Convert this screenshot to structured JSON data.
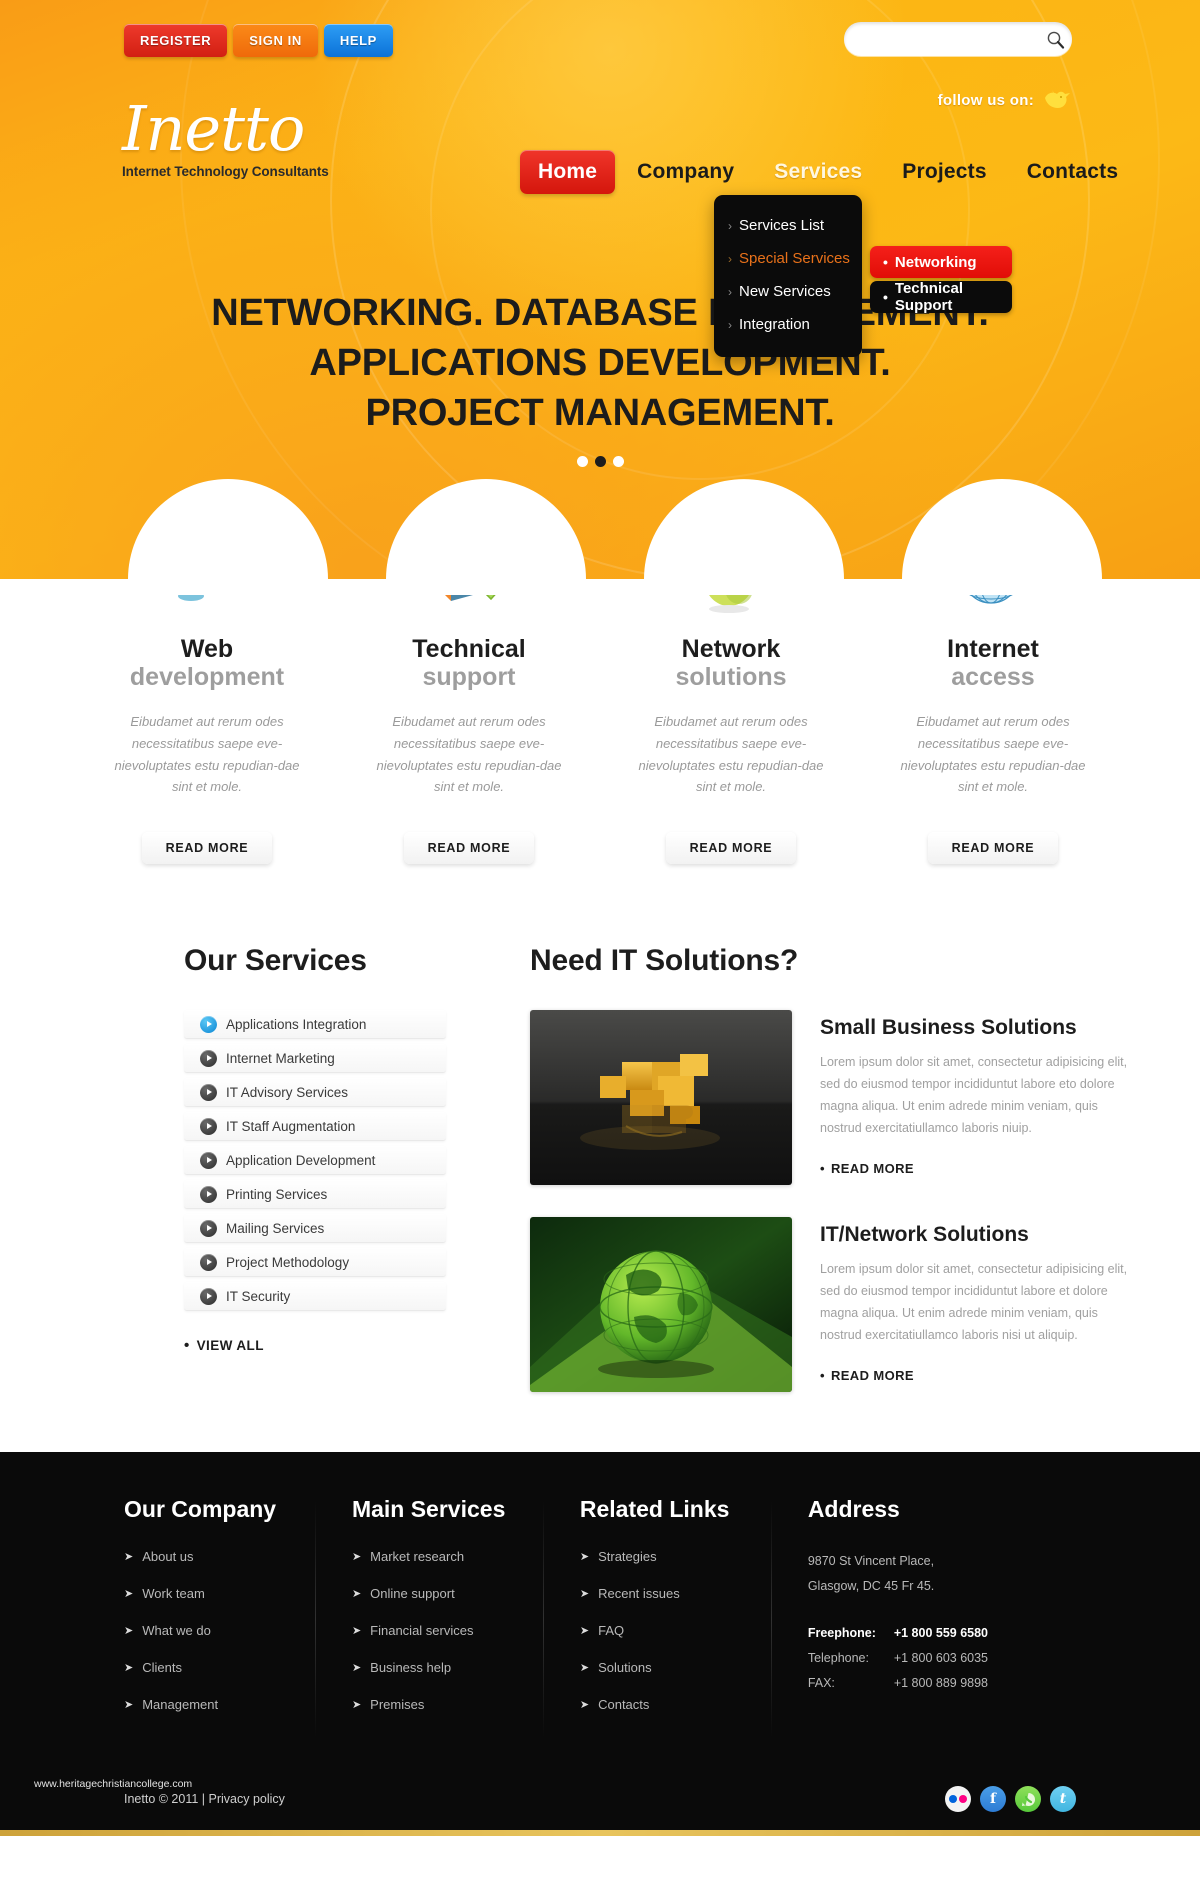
{
  "header": {
    "auth_buttons": [
      {
        "label": "REGISTER",
        "name": "register-button"
      },
      {
        "label": "SIGN IN",
        "name": "signin-button"
      },
      {
        "label": "HELP",
        "name": "help-button"
      }
    ],
    "search": {
      "value": "",
      "placeholder": "",
      "icon": "search-icon"
    },
    "follow_label": "follow us on:",
    "follow_icon": "twitter-bird-icon",
    "logo_name": "Inetto",
    "logo_tagline": "Internet Technology Consultants"
  },
  "nav": {
    "items": [
      {
        "label": "Home",
        "state": "active"
      },
      {
        "label": "Company",
        "state": "normal"
      },
      {
        "label": "Services",
        "state": "hovered"
      },
      {
        "label": "Projects",
        "state": "normal"
      },
      {
        "label": "Contacts",
        "state": "normal"
      }
    ],
    "dropdown": [
      {
        "label": "Services List",
        "state": "normal"
      },
      {
        "label": "Special Services",
        "state": "highlighted"
      },
      {
        "label": "New Services",
        "state": "normal"
      },
      {
        "label": "Integration",
        "state": "normal"
      }
    ],
    "submenu": [
      {
        "label": "Networking",
        "state": "active"
      },
      {
        "label": "Technical Support",
        "state": "normal"
      }
    ]
  },
  "hero": {
    "headline_line1": "NETWORKING. DATABASE MANAGEMENT.",
    "headline_line2": "APPLICATIONS DEVELOPMENT.",
    "headline_line3": "PROJECT MANAGEMENT.",
    "slider_dots": 3,
    "active_dot": 1
  },
  "cards": [
    {
      "title": "Web",
      "subtitle": "development",
      "text": "Eibudamet aut rerum odes necessitatibus saepe eve-nievoluptates estu repudian-dae sint et mole.",
      "more": "READ MORE",
      "icon": "monitor-cubes-icon"
    },
    {
      "title": "Technical",
      "subtitle": "support",
      "text": "Eibudamet aut rerum odes necessitatibus saepe eve-nievoluptates estu repudian-dae sint et mole.",
      "more": "READ MORE",
      "icon": "disk-download-icon"
    },
    {
      "title": "Network",
      "subtitle": "solutions",
      "text": "Eibudamet aut rerum odes necessitatibus saepe eve-nievoluptates estu repudian-dae sint et mole.",
      "more": "READ MORE",
      "icon": "green-apple-icon"
    },
    {
      "title": "Internet",
      "subtitle": "access",
      "text": "Eibudamet aut rerum odes necessitatibus saepe eve-nievoluptates estu repudian-dae sint et mole.",
      "more": "READ MORE",
      "icon": "globe-pin-icon"
    }
  ],
  "our_services": {
    "title": "Our Services",
    "items": [
      {
        "label": "Applications Integration",
        "state": "active"
      },
      {
        "label": "Internet Marketing",
        "state": "normal"
      },
      {
        "label": "IT Advisory Services",
        "state": "normal"
      },
      {
        "label": "IT Staff Augmentation",
        "state": "normal"
      },
      {
        "label": "Application Development",
        "state": "normal"
      },
      {
        "label": "Printing Services",
        "state": "normal"
      },
      {
        "label": "Mailing Services",
        "state": "normal"
      },
      {
        "label": "Project Methodology",
        "state": "normal"
      },
      {
        "label": "IT Security",
        "state": "normal"
      }
    ],
    "view_all": "VIEW ALL"
  },
  "solutions": {
    "title": "Need IT Solutions?",
    "items": [
      {
        "title": "Small Business Solutions",
        "text": "Lorem ipsum dolor sit amet, consectetur adipisicing elit, sed do eiusmod tempor incididuntut labore eto dolore magna aliqua. Ut enim adrede minim veniam, quis nostrud exercitatiullamco laboris niuip.",
        "more": "READ MORE",
        "thumb": "gold-puzzle-pieces-image"
      },
      {
        "title": "IT/Network Solutions",
        "text": "Lorem ipsum dolor sit amet, consectetur adipisicing elit, sed do eiusmod tempor incididuntut labore et dolore magna aliqua. Ut enim adrede minim veniam, quis nostrud exercitatiullamco laboris nisi ut aliquip.",
        "more": "READ MORE",
        "thumb": "green-globe-image"
      }
    ]
  },
  "footer": {
    "columns": [
      {
        "title": "Our Company",
        "links": [
          "About us",
          "Work team",
          "What we do",
          "Clients",
          "Management"
        ]
      },
      {
        "title": "Main Services",
        "links": [
          "Market research",
          "Online support",
          "Financial services",
          "Business help",
          "Premises"
        ]
      },
      {
        "title": "Related Links",
        "links": [
          "Strategies",
          "Recent issues",
          "FAQ",
          "Solutions",
          "Contacts"
        ]
      }
    ],
    "address": {
      "title": "Address",
      "line1": "9870 St Vincent Place,",
      "line2": "Glasgow, DC 45 Fr 45.",
      "phones": [
        {
          "label": "Freephone:",
          "value": "+1 800 559 6580",
          "bold": true
        },
        {
          "label": "Telephone:",
          "value": "+1 800 603 6035",
          "bold": false
        },
        {
          "label": "FAX:",
          "value": "+1 800 889 9898",
          "bold": false
        }
      ]
    },
    "watermark": "www.heritagechristiancollege.com",
    "copyright": "Inetto © 2011 | Privacy policy",
    "socials": [
      {
        "name": "flickr-icon",
        "glyph": ""
      },
      {
        "name": "facebook-icon",
        "glyph": "f"
      },
      {
        "name": "whatsapp-icon",
        "glyph": ""
      },
      {
        "name": "twitter-icon",
        "glyph": "t"
      }
    ]
  },
  "colors": {
    "brand_orange": "#fcb415",
    "accent_red": "#e10d07",
    "accent_blue": "#0b72d8",
    "footer_bg": "#0a0a0a",
    "muted_text": "#9e9e9e"
  }
}
